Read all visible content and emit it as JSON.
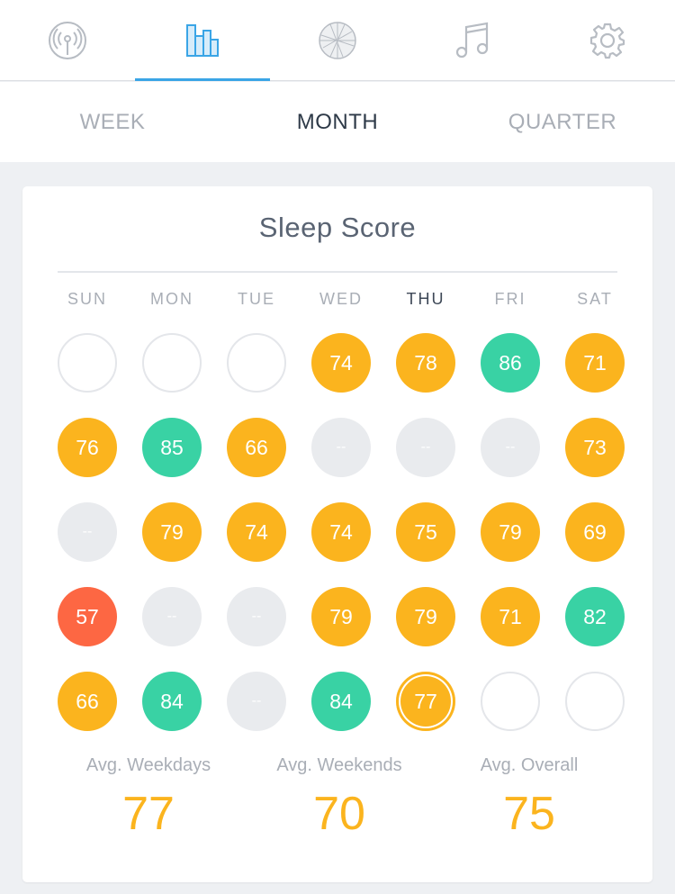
{
  "tabs": [
    {
      "name": "tab-live",
      "icon": "antenna-icon",
      "active": false
    },
    {
      "name": "tab-stats",
      "icon": "bar-chart-icon",
      "active": true
    },
    {
      "name": "tab-sphere",
      "icon": "globe-icon",
      "active": false
    },
    {
      "name": "tab-music",
      "icon": "music-note-icon",
      "active": false
    },
    {
      "name": "tab-settings",
      "icon": "gear-icon",
      "active": false
    }
  ],
  "periods": {
    "week": "WEEK",
    "month": "MONTH",
    "quarter": "QUARTER",
    "selected": "month"
  },
  "card": {
    "title": "Sleep Score"
  },
  "days": [
    "SUN",
    "MON",
    "TUE",
    "WED",
    "THU",
    "FRI",
    "SAT"
  ],
  "today_day_index": 4,
  "calendar": [
    [
      {
        "t": "empty",
        "v": ""
      },
      {
        "t": "empty",
        "v": ""
      },
      {
        "t": "empty",
        "v": ""
      },
      {
        "t": "yellow",
        "v": "74"
      },
      {
        "t": "yellow",
        "v": "78"
      },
      {
        "t": "green",
        "v": "86"
      },
      {
        "t": "yellow",
        "v": "71"
      }
    ],
    [
      {
        "t": "yellow",
        "v": "76"
      },
      {
        "t": "green",
        "v": "85"
      },
      {
        "t": "yellow",
        "v": "66"
      },
      {
        "t": "none",
        "v": "--"
      },
      {
        "t": "none",
        "v": "--"
      },
      {
        "t": "none",
        "v": "--"
      },
      {
        "t": "yellow",
        "v": "73"
      }
    ],
    [
      {
        "t": "none",
        "v": "--"
      },
      {
        "t": "yellow",
        "v": "79"
      },
      {
        "t": "yellow",
        "v": "74"
      },
      {
        "t": "yellow",
        "v": "74"
      },
      {
        "t": "yellow",
        "v": "75"
      },
      {
        "t": "yellow",
        "v": "79"
      },
      {
        "t": "yellow",
        "v": "69"
      }
    ],
    [
      {
        "t": "red",
        "v": "57"
      },
      {
        "t": "none",
        "v": "--"
      },
      {
        "t": "none",
        "v": "--"
      },
      {
        "t": "yellow",
        "v": "79"
      },
      {
        "t": "yellow",
        "v": "79"
      },
      {
        "t": "yellow",
        "v": "71"
      },
      {
        "t": "green",
        "v": "82"
      }
    ],
    [
      {
        "t": "yellow",
        "v": "66"
      },
      {
        "t": "green",
        "v": "84"
      },
      {
        "t": "none",
        "v": "--"
      },
      {
        "t": "green",
        "v": "84"
      },
      {
        "t": "yellow",
        "v": "77",
        "today": true
      },
      {
        "t": "empty",
        "v": ""
      },
      {
        "t": "empty",
        "v": ""
      }
    ]
  ],
  "averages": {
    "weekdays": {
      "label": "Avg. Weekdays",
      "value": "77"
    },
    "weekends": {
      "label": "Avg. Weekends",
      "value": "70"
    },
    "overall": {
      "label": "Avg. Overall",
      "value": "75"
    }
  },
  "colors": {
    "good": "#39d2a4",
    "fair": "#fbb41e",
    "poor": "#fd6743",
    "accent": "#3aa5e6"
  }
}
